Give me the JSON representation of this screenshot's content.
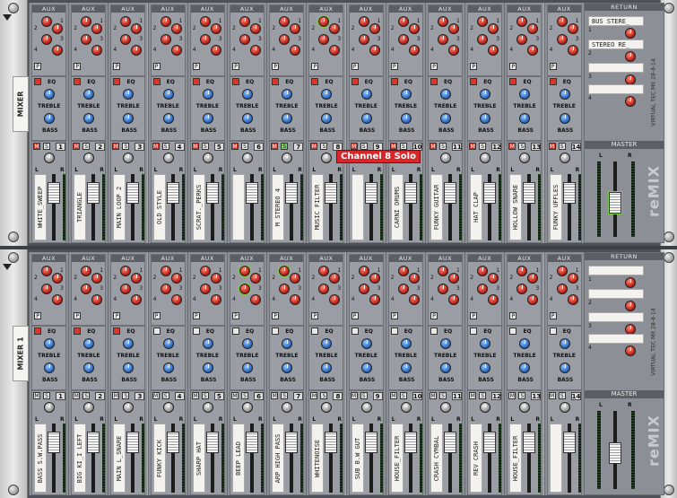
{
  "mixers": [
    {
      "device_label": "MIXER",
      "channels": [
        {
          "n": "1",
          "name": "WHITE_SWEEP"
        },
        {
          "n": "2",
          "name": "TRIANGLE"
        },
        {
          "n": "3",
          "name": "MAIN LOOP 2"
        },
        {
          "n": "4",
          "name": "OLD STYLE"
        },
        {
          "n": "5",
          "name": "SCRAT._PERKS"
        },
        {
          "n": "6",
          "name": ""
        },
        {
          "n": "7",
          "name": "M STEREO 4"
        },
        {
          "n": "8",
          "name": "MUSIC FILTER"
        },
        {
          "n": "9",
          "name": ""
        },
        {
          "n": "10",
          "name": "CARNI DRUMS"
        },
        {
          "n": "11",
          "name": "FUNKY GUITAR"
        },
        {
          "n": "12",
          "name": "HAT CLAP"
        },
        {
          "n": "13",
          "name": "HOLLOW SNARE"
        },
        {
          "n": "14",
          "name": "FUNKY UFFLES"
        }
      ],
      "returns": [
        "BUS STERE_",
        "STEREO RE_",
        "",
        ""
      ]
    },
    {
      "device_label": "MIXER 1",
      "channels": [
        {
          "n": "1",
          "name": "BASS S.W.PASS"
        },
        {
          "n": "2",
          "name": "BIG KI_I LEFT"
        },
        {
          "n": "3",
          "name": "MAIN L_SNARE"
        },
        {
          "n": "4",
          "name": "FUNKY KICK"
        },
        {
          "n": "5",
          "name": "SHARP HAT"
        },
        {
          "n": "6",
          "name": "BEEP LEAD"
        },
        {
          "n": "7",
          "name": "ARP HIGH PASS"
        },
        {
          "n": "8",
          "name": "WHITENOISE"
        },
        {
          "n": "9",
          "name": "SUB B.W GUT"
        },
        {
          "n": "10",
          "name": "HOUSE_FILTER"
        },
        {
          "n": "11",
          "name": "CRASH CYMBAL"
        },
        {
          "n": "12",
          "name": "REV CRASH"
        },
        {
          "n": "13",
          "name": "HOUSE_FILTER"
        },
        {
          "n": "14",
          "name": ""
        }
      ],
      "returns": [
        "",
        "",
        "",
        ""
      ]
    }
  ],
  "labels": {
    "aux": "AUX",
    "eq": "EQ",
    "treble": "TREBLE",
    "bass": "BASS",
    "mute": "M",
    "solo": "S",
    "pan_l": "L",
    "pan_r": "R",
    "return": "RETURN",
    "master": "MASTER",
    "logo": "reMIX",
    "logo_sub": "VIRTUAL TEC MX 28-4-14",
    "aux_nums": [
      "1",
      "2",
      "3",
      "4"
    ]
  },
  "tooltip": "Channel 8 Solo",
  "icons": {
    "screw": "screw-icon",
    "menu": "device-menu-triangle-icon"
  },
  "colors": {
    "send_knob": "#c0261b",
    "eq_knob": "#2f6fc6",
    "highlight": "#7ed33c",
    "tooltip": "#d8262a"
  }
}
